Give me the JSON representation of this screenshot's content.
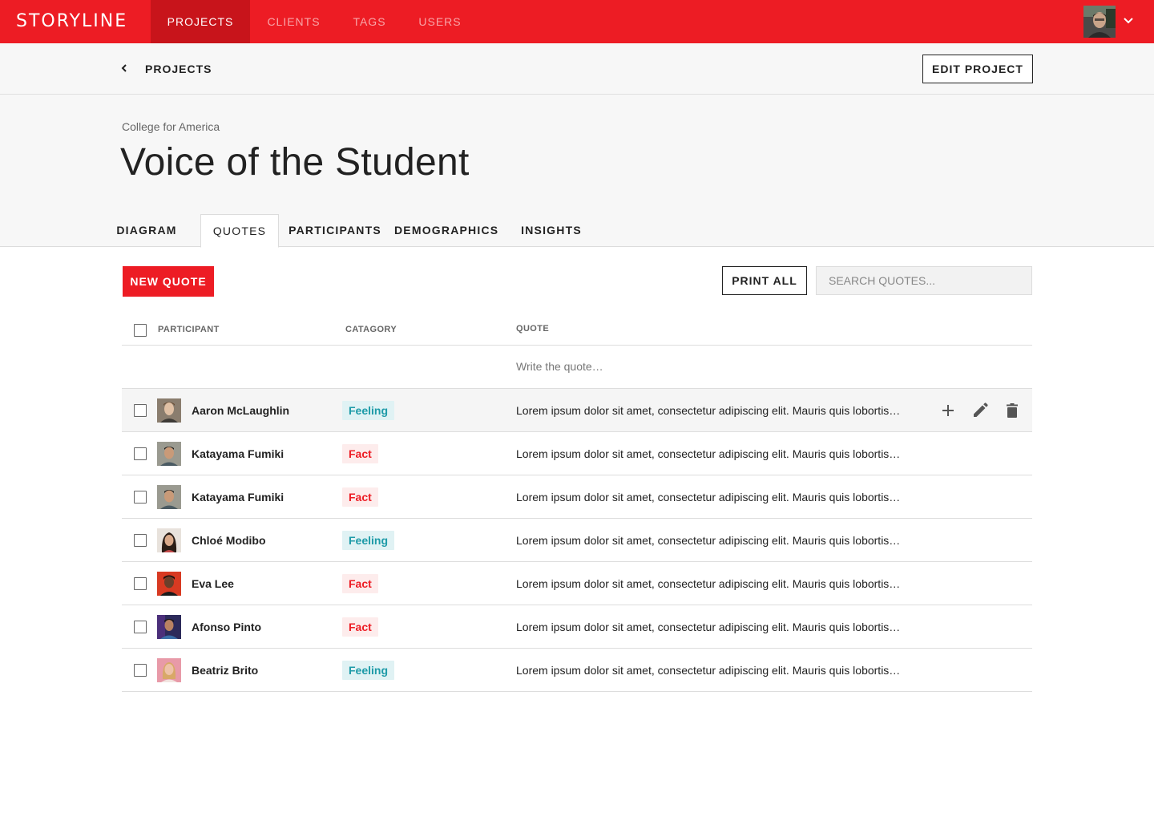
{
  "app": {
    "logo": "STORYLINE",
    "nav": [
      {
        "label": "PROJECTS",
        "active": true
      },
      {
        "label": "CLIENTS",
        "active": false
      },
      {
        "label": "TAGS",
        "active": false
      },
      {
        "label": "USERS",
        "active": false
      }
    ],
    "accent_color": "#ED1C24"
  },
  "subheader": {
    "breadcrumb": "PROJECTS",
    "edit_label": "EDIT PROJECT"
  },
  "project": {
    "client": "College for America",
    "title": "Voice of the Student"
  },
  "tabs": [
    {
      "label": "DIAGRAM",
      "active": false
    },
    {
      "label": "QUOTES",
      "active": true
    },
    {
      "label": "PARTICIPANTS",
      "active": false
    },
    {
      "label": "DEMOGRAPHICS",
      "active": false
    },
    {
      "label": "INSIGHTS",
      "active": false
    }
  ],
  "toolbar": {
    "new_label": "NEW QUOTE",
    "print_label": "PRINT ALL",
    "search_placeholder": "SEARCH QUOTES..."
  },
  "table": {
    "headers": {
      "participant": "PARTICIPANT",
      "category": "CATAGORY",
      "quote": "QUOTE"
    },
    "write_placeholder": "Write the quote…",
    "rows": [
      {
        "name": "Aaron McLaughlin",
        "category": "Feeling",
        "quote": "Lorem ipsum dolor sit amet, consectetur adipiscing elit. Mauris quis lobortis…"
      },
      {
        "name": "Katayama Fumiki",
        "category": "Fact",
        "quote": "Lorem ipsum dolor sit amet, consectetur adipiscing elit. Mauris quis lobortis…"
      },
      {
        "name": "Katayama Fumiki",
        "category": "Fact",
        "quote": "Lorem ipsum dolor sit amet, consectetur adipiscing elit. Mauris quis lobortis…"
      },
      {
        "name": "Chloé Modibo",
        "category": "Feeling",
        "quote": "Lorem ipsum dolor sit amet, consectetur adipiscing elit. Mauris quis lobortis…"
      },
      {
        "name": "Eva Lee",
        "category": "Fact",
        "quote": "Lorem ipsum dolor sit amet, consectetur adipiscing elit. Mauris quis lobortis…"
      },
      {
        "name": "Afonso Pinto",
        "category": "Fact",
        "quote": "Lorem ipsum dolor sit amet, consectetur adipiscing elit. Mauris quis lobortis…"
      },
      {
        "name": "Beatriz Brito",
        "category": "Feeling",
        "quote": "Lorem ipsum dolor sit amet, consectetur adipiscing elit. Mauris quis lobortis…"
      }
    ],
    "row_actions": [
      "plus-icon",
      "pencil-icon",
      "trash-icon"
    ]
  }
}
